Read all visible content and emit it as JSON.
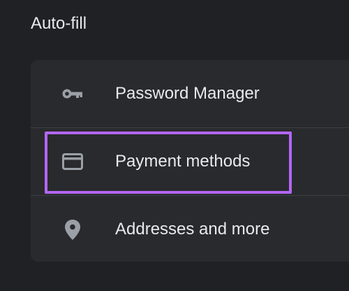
{
  "section": {
    "title": "Auto-fill"
  },
  "items": [
    {
      "label": "Password Manager",
      "icon": "key-icon"
    },
    {
      "label": "Payment methods",
      "icon": "credit-card-icon"
    },
    {
      "label": "Addresses and more",
      "icon": "location-pin-icon"
    }
  ],
  "colors": {
    "background": "#202124",
    "card": "#292a2d",
    "text": "#e8eaed",
    "icon": "#9aa0a6",
    "highlight": "#b366f5",
    "divider": "#3c4043"
  }
}
